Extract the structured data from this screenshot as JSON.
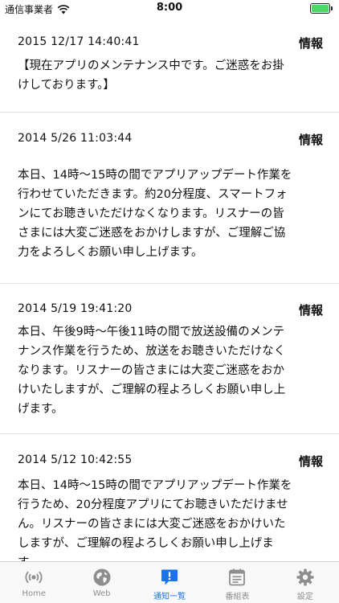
{
  "status_bar": {
    "carrier": "通信事業者",
    "time": "8:00"
  },
  "notices": [
    {
      "date": "2015 12/17 14:40:41",
      "tag": "情報",
      "lines": [
        "【現在アプリのメンテナンス中です。ご迷惑をお掛",
        "けしております。】"
      ]
    },
    {
      "date": "2014 5/26 11:03:44",
      "tag": "情報",
      "lines": [
        "本日、14時〜15時の間でアプリアップデート作業を",
        "行わせていただきます。約20分程度、スマートフォ",
        "ンにてお聴きいただけなくなります。リスナーの皆",
        "さまには大変ご迷惑をおかけしますが、ご理解ご協",
        "力をよろしくお願い申し上げます。"
      ]
    },
    {
      "date": "2014 5/19 19:41:20",
      "tag": "情報",
      "lines": [
        "本日、午後9時〜午後11時の間で放送設備のメンテ",
        "ナンス作業を行うため、放送をお聴きいただけなく",
        "なります。リスナーの皆さまには大変ご迷惑をおか",
        "けいたしますが、ご理解の程よろしくお願い申し上",
        "げます。"
      ]
    },
    {
      "date": "2014 5/12 10:42:55",
      "tag": "情報",
      "lines": [
        "本日、14時〜15時の間でアプリアップデート作業を",
        "行うため、20分程度アプリにてお聴きいただけませ",
        "ん。リスナーの皆さまには大変ご迷惑をおかけいた",
        "しますが、ご理解の程よろしくお願い申し上げま",
        "す。"
      ]
    }
  ],
  "tabs": [
    {
      "label": "Home",
      "icon": "radio-icon"
    },
    {
      "label": "Web",
      "icon": "globe-icon"
    },
    {
      "label": "通知一覧",
      "icon": "notification-icon"
    },
    {
      "label": "番組表",
      "icon": "schedule-icon"
    },
    {
      "label": "設定",
      "icon": "gear-icon"
    }
  ],
  "colors": {
    "accent": "#1a73e8",
    "inactive": "#8e8e8e",
    "battery": "#4cd964"
  }
}
